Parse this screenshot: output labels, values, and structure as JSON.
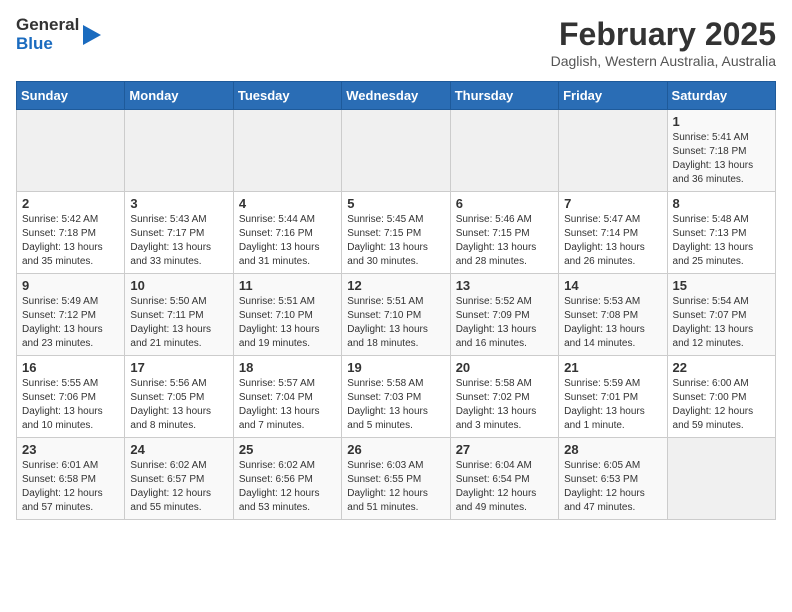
{
  "logo": {
    "general": "General",
    "blue": "Blue"
  },
  "title": "February 2025",
  "location": "Daglish, Western Australia, Australia",
  "days_of_week": [
    "Sunday",
    "Monday",
    "Tuesday",
    "Wednesday",
    "Thursday",
    "Friday",
    "Saturday"
  ],
  "weeks": [
    [
      {
        "day": "",
        "info": ""
      },
      {
        "day": "",
        "info": ""
      },
      {
        "day": "",
        "info": ""
      },
      {
        "day": "",
        "info": ""
      },
      {
        "day": "",
        "info": ""
      },
      {
        "day": "",
        "info": ""
      },
      {
        "day": "1",
        "info": "Sunrise: 5:41 AM\nSunset: 7:18 PM\nDaylight: 13 hours\nand 36 minutes."
      }
    ],
    [
      {
        "day": "2",
        "info": "Sunrise: 5:42 AM\nSunset: 7:18 PM\nDaylight: 13 hours\nand 35 minutes."
      },
      {
        "day": "3",
        "info": "Sunrise: 5:43 AM\nSunset: 7:17 PM\nDaylight: 13 hours\nand 33 minutes."
      },
      {
        "day": "4",
        "info": "Sunrise: 5:44 AM\nSunset: 7:16 PM\nDaylight: 13 hours\nand 31 minutes."
      },
      {
        "day": "5",
        "info": "Sunrise: 5:45 AM\nSunset: 7:15 PM\nDaylight: 13 hours\nand 30 minutes."
      },
      {
        "day": "6",
        "info": "Sunrise: 5:46 AM\nSunset: 7:15 PM\nDaylight: 13 hours\nand 28 minutes."
      },
      {
        "day": "7",
        "info": "Sunrise: 5:47 AM\nSunset: 7:14 PM\nDaylight: 13 hours\nand 26 minutes."
      },
      {
        "day": "8",
        "info": "Sunrise: 5:48 AM\nSunset: 7:13 PM\nDaylight: 13 hours\nand 25 minutes."
      }
    ],
    [
      {
        "day": "9",
        "info": "Sunrise: 5:49 AM\nSunset: 7:12 PM\nDaylight: 13 hours\nand 23 minutes."
      },
      {
        "day": "10",
        "info": "Sunrise: 5:50 AM\nSunset: 7:11 PM\nDaylight: 13 hours\nand 21 minutes."
      },
      {
        "day": "11",
        "info": "Sunrise: 5:51 AM\nSunset: 7:10 PM\nDaylight: 13 hours\nand 19 minutes."
      },
      {
        "day": "12",
        "info": "Sunrise: 5:51 AM\nSunset: 7:10 PM\nDaylight: 13 hours\nand 18 minutes."
      },
      {
        "day": "13",
        "info": "Sunrise: 5:52 AM\nSunset: 7:09 PM\nDaylight: 13 hours\nand 16 minutes."
      },
      {
        "day": "14",
        "info": "Sunrise: 5:53 AM\nSunset: 7:08 PM\nDaylight: 13 hours\nand 14 minutes."
      },
      {
        "day": "15",
        "info": "Sunrise: 5:54 AM\nSunset: 7:07 PM\nDaylight: 13 hours\nand 12 minutes."
      }
    ],
    [
      {
        "day": "16",
        "info": "Sunrise: 5:55 AM\nSunset: 7:06 PM\nDaylight: 13 hours\nand 10 minutes."
      },
      {
        "day": "17",
        "info": "Sunrise: 5:56 AM\nSunset: 7:05 PM\nDaylight: 13 hours\nand 8 minutes."
      },
      {
        "day": "18",
        "info": "Sunrise: 5:57 AM\nSunset: 7:04 PM\nDaylight: 13 hours\nand 7 minutes."
      },
      {
        "day": "19",
        "info": "Sunrise: 5:58 AM\nSunset: 7:03 PM\nDaylight: 13 hours\nand 5 minutes."
      },
      {
        "day": "20",
        "info": "Sunrise: 5:58 AM\nSunset: 7:02 PM\nDaylight: 13 hours\nand 3 minutes."
      },
      {
        "day": "21",
        "info": "Sunrise: 5:59 AM\nSunset: 7:01 PM\nDaylight: 13 hours\nand 1 minute."
      },
      {
        "day": "22",
        "info": "Sunrise: 6:00 AM\nSunset: 7:00 PM\nDaylight: 12 hours\nand 59 minutes."
      }
    ],
    [
      {
        "day": "23",
        "info": "Sunrise: 6:01 AM\nSunset: 6:58 PM\nDaylight: 12 hours\nand 57 minutes."
      },
      {
        "day": "24",
        "info": "Sunrise: 6:02 AM\nSunset: 6:57 PM\nDaylight: 12 hours\nand 55 minutes."
      },
      {
        "day": "25",
        "info": "Sunrise: 6:02 AM\nSunset: 6:56 PM\nDaylight: 12 hours\nand 53 minutes."
      },
      {
        "day": "26",
        "info": "Sunrise: 6:03 AM\nSunset: 6:55 PM\nDaylight: 12 hours\nand 51 minutes."
      },
      {
        "day": "27",
        "info": "Sunrise: 6:04 AM\nSunset: 6:54 PM\nDaylight: 12 hours\nand 49 minutes."
      },
      {
        "day": "28",
        "info": "Sunrise: 6:05 AM\nSunset: 6:53 PM\nDaylight: 12 hours\nand 47 minutes."
      },
      {
        "day": "",
        "info": ""
      }
    ]
  ]
}
